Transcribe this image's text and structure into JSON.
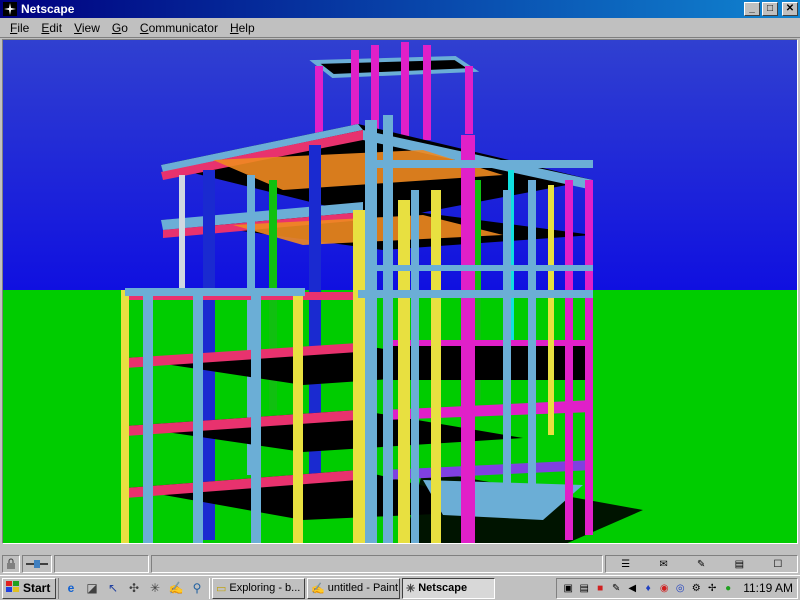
{
  "window": {
    "title": "Netscape",
    "controls": {
      "minimize": "_",
      "maximize": "□",
      "close": "✕"
    }
  },
  "menu": [
    {
      "key": "F",
      "rest": "ile"
    },
    {
      "key": "E",
      "rest": "dit"
    },
    {
      "key": "V",
      "rest": "iew"
    },
    {
      "key": "G",
      "rest": "o"
    },
    {
      "key": "C",
      "rest": "ommunicator"
    },
    {
      "key": "H",
      "rest": "elp"
    }
  ],
  "scene": {
    "sky_color": "#1010e0",
    "ground_color": "#00cc00",
    "colors": {
      "column_blue": "#6baed6",
      "beam_red": "#e8326e",
      "column_yellow": "#e8e040",
      "column_magenta": "#e020c8",
      "slab": "#000000",
      "orange": "#f08a20",
      "green": "#10c010",
      "dark_blue": "#1a2ad0"
    }
  },
  "taskbar": {
    "start_label": "Start",
    "quick_launch_icons": [
      "ie-icon",
      "outlook-icon",
      "arrow-icon",
      "tool-icon",
      "netscape-icon",
      "paint-icon",
      "tool2-icon"
    ],
    "tasks": [
      {
        "label": "Exploring - b...",
        "icon": "folder-icon",
        "active": false
      },
      {
        "label": "untitled - Paint",
        "icon": "paint-icon",
        "active": false
      },
      {
        "label": "Netscape",
        "icon": "netscape-icon",
        "active": true
      }
    ],
    "clock": "11:19 AM"
  },
  "colors": {
    "title_start": "#000080",
    "title_end": "#1084d0",
    "chrome": "#c0c0c0"
  }
}
